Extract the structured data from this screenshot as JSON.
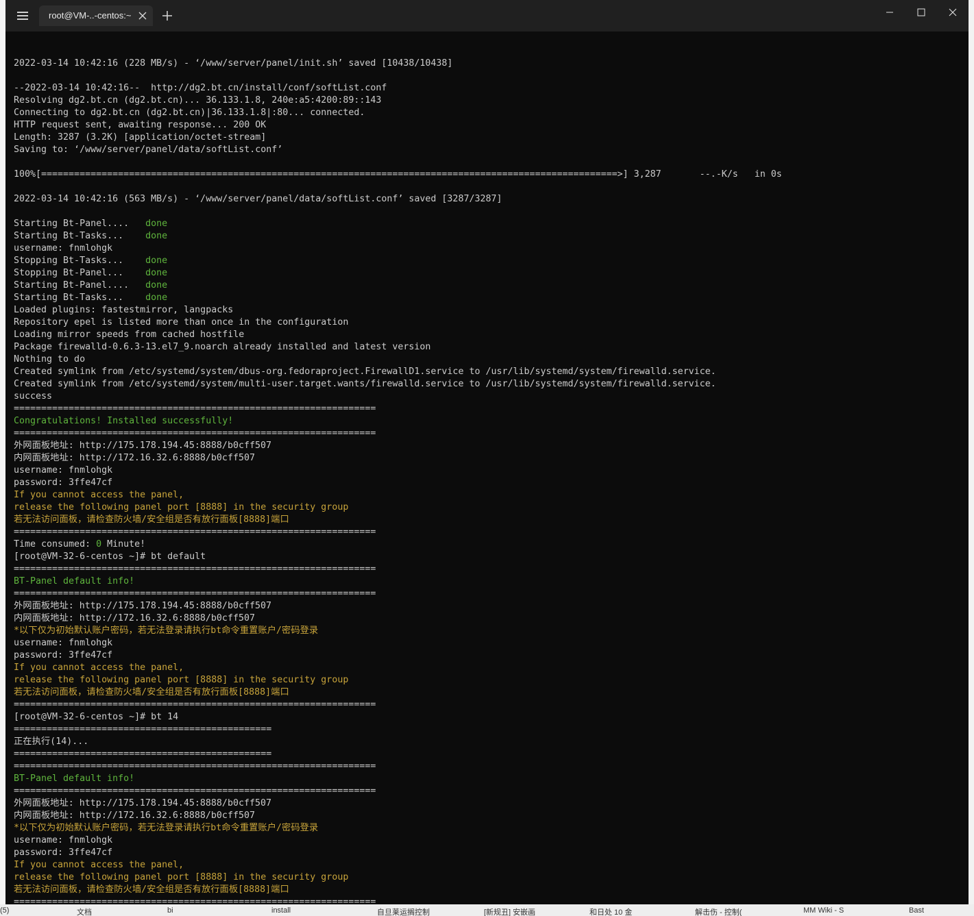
{
  "window": {
    "tab_title": "root@VM-..-centos:~"
  },
  "terminal": {
    "lines": [
      {
        "parts": [
          {
            "t": ""
          }
        ]
      },
      {
        "parts": [
          {
            "t": "2022-03-14 10:42:16 (228 MB/s) - ‘/www/server/panel/init.sh’ saved [10438/10438]"
          }
        ]
      },
      {
        "parts": [
          {
            "t": ""
          }
        ]
      },
      {
        "parts": [
          {
            "t": "--2022-03-14 10:42:16--  http://dg2.bt.cn/install/conf/softList.conf"
          }
        ]
      },
      {
        "parts": [
          {
            "t": "Resolving dg2.bt.cn (dg2.bt.cn)... 36.133.1.8, 240e:a5:4200:89::143"
          }
        ]
      },
      {
        "parts": [
          {
            "t": "Connecting to dg2.bt.cn (dg2.bt.cn)|36.133.1.8|:80... connected."
          }
        ]
      },
      {
        "parts": [
          {
            "t": "HTTP request sent, awaiting response... 200 OK"
          }
        ]
      },
      {
        "parts": [
          {
            "t": "Length: 3287 (3.2K) [application/octet-stream]"
          }
        ]
      },
      {
        "parts": [
          {
            "t": "Saving to: ‘/www/server/panel/data/softList.conf’"
          }
        ]
      },
      {
        "parts": [
          {
            "t": ""
          }
        ]
      },
      {
        "parts": [
          {
            "t": "100%[=========================================================================================================>] 3,287       --.-K/s   in 0s"
          }
        ]
      },
      {
        "parts": [
          {
            "t": ""
          }
        ]
      },
      {
        "parts": [
          {
            "t": "2022-03-14 10:42:16 (563 MB/s) - ‘/www/server/panel/data/softList.conf’ saved [3287/3287]"
          }
        ]
      },
      {
        "parts": [
          {
            "t": ""
          }
        ]
      },
      {
        "parts": [
          {
            "t": "Starting Bt-Panel....   "
          },
          {
            "t": "done",
            "c": "green"
          }
        ]
      },
      {
        "parts": [
          {
            "t": "Starting Bt-Tasks...    "
          },
          {
            "t": "done",
            "c": "green"
          }
        ]
      },
      {
        "parts": [
          {
            "t": "username: fnmlohgk"
          }
        ]
      },
      {
        "parts": [
          {
            "t": "Stopping Bt-Tasks...    "
          },
          {
            "t": "done",
            "c": "green"
          }
        ]
      },
      {
        "parts": [
          {
            "t": "Stopping Bt-Panel...    "
          },
          {
            "t": "done",
            "c": "green"
          }
        ]
      },
      {
        "parts": [
          {
            "t": "Starting Bt-Panel....   "
          },
          {
            "t": "done",
            "c": "green"
          }
        ]
      },
      {
        "parts": [
          {
            "t": "Starting Bt-Tasks...    "
          },
          {
            "t": "done",
            "c": "green"
          }
        ]
      },
      {
        "parts": [
          {
            "t": "Loaded plugins: fastestmirror, langpacks"
          }
        ]
      },
      {
        "parts": [
          {
            "t": "Repository epel is listed more than once in the configuration"
          }
        ]
      },
      {
        "parts": [
          {
            "t": "Loading mirror speeds from cached hostfile"
          }
        ]
      },
      {
        "parts": [
          {
            "t": "Package firewalld-0.6.3-13.el7_9.noarch already installed and latest version"
          }
        ]
      },
      {
        "parts": [
          {
            "t": "Nothing to do"
          }
        ]
      },
      {
        "parts": [
          {
            "t": "Created symlink from /etc/systemd/system/dbus-org.fedoraproject.FirewallD1.service to /usr/lib/systemd/system/firewalld.service."
          }
        ]
      },
      {
        "parts": [
          {
            "t": "Created symlink from /etc/systemd/system/multi-user.target.wants/firewalld.service to /usr/lib/systemd/system/firewalld.service."
          }
        ]
      },
      {
        "parts": [
          {
            "t": "success"
          }
        ]
      },
      {
        "parts": [
          {
            "t": "=================================================================="
          }
        ]
      },
      {
        "parts": [
          {
            "t": "Congratulations! Installed successfully!",
            "c": "green"
          }
        ]
      },
      {
        "parts": [
          {
            "t": "=================================================================="
          }
        ]
      },
      {
        "parts": [
          {
            "t": "外网面板地址: http://175.178.194.45:8888/b0cff507"
          }
        ]
      },
      {
        "parts": [
          {
            "t": "内网面板地址: http://172.16.32.6:8888/b0cff507"
          }
        ]
      },
      {
        "parts": [
          {
            "t": "username: fnmlohgk"
          }
        ]
      },
      {
        "parts": [
          {
            "t": "password: 3ffe47cf"
          }
        ]
      },
      {
        "parts": [
          {
            "t": "If you cannot access the panel,",
            "c": "yellow"
          }
        ]
      },
      {
        "parts": [
          {
            "t": "release the following panel port [8888] in the security group",
            "c": "yellow"
          }
        ]
      },
      {
        "parts": [
          {
            "t": "若无法访问面板，请检查防火墙/安全组是否有放行面板[8888]端口",
            "c": "yellow"
          }
        ]
      },
      {
        "parts": [
          {
            "t": "=================================================================="
          }
        ]
      },
      {
        "parts": [
          {
            "t": "Time consumed: "
          },
          {
            "t": "0",
            "c": "green"
          },
          {
            "t": " Minute!"
          }
        ]
      },
      {
        "parts": [
          {
            "t": "[root@VM-32-6-centos ~]# bt default"
          }
        ]
      },
      {
        "parts": [
          {
            "t": "=================================================================="
          }
        ]
      },
      {
        "parts": [
          {
            "t": "BT-Panel default info!",
            "c": "green"
          }
        ]
      },
      {
        "parts": [
          {
            "t": "=================================================================="
          }
        ]
      },
      {
        "parts": [
          {
            "t": "外网面板地址: http://175.178.194.45:8888/b0cff507"
          }
        ]
      },
      {
        "parts": [
          {
            "t": "内网面板地址: http://172.16.32.6:8888/b0cff507"
          }
        ]
      },
      {
        "parts": [
          {
            "t": "*以下仅为初始默认账户密码，若无法登录请执行bt命令重置账户/密码登录",
            "c": "yellow"
          }
        ]
      },
      {
        "parts": [
          {
            "t": "username: fnmlohgk"
          }
        ]
      },
      {
        "parts": [
          {
            "t": "password: 3ffe47cf"
          }
        ]
      },
      {
        "parts": [
          {
            "t": "If you cannot access the panel,",
            "c": "yellow"
          }
        ]
      },
      {
        "parts": [
          {
            "t": "release the following panel port [8888] in the security group",
            "c": "yellow"
          }
        ]
      },
      {
        "parts": [
          {
            "t": "若无法访问面板，请检查防火墙/安全组是否有放行面板[8888]端口",
            "c": "yellow"
          }
        ]
      },
      {
        "parts": [
          {
            "t": "=================================================================="
          }
        ]
      },
      {
        "parts": [
          {
            "t": "[root@VM-32-6-centos ~]# bt 14"
          }
        ]
      },
      {
        "parts": [
          {
            "t": "==============================================="
          }
        ]
      },
      {
        "parts": [
          {
            "t": "正在执行(14)..."
          }
        ]
      },
      {
        "parts": [
          {
            "t": "==============================================="
          }
        ]
      },
      {
        "parts": [
          {
            "t": "=================================================================="
          }
        ]
      },
      {
        "parts": [
          {
            "t": "BT-Panel default info!",
            "c": "green"
          }
        ]
      },
      {
        "parts": [
          {
            "t": "=================================================================="
          }
        ]
      },
      {
        "parts": [
          {
            "t": "外网面板地址: http://175.178.194.45:8888/b0cff507"
          }
        ]
      },
      {
        "parts": [
          {
            "t": "内网面板地址: http://172.16.32.6:8888/b0cff507"
          }
        ]
      },
      {
        "parts": [
          {
            "t": "*以下仅为初始默认账户密码，若无法登录请执行bt命令重置账户/密码登录",
            "c": "yellow"
          }
        ]
      },
      {
        "parts": [
          {
            "t": "username: fnmlohgk"
          }
        ]
      },
      {
        "parts": [
          {
            "t": "password: 3ffe47cf"
          }
        ]
      },
      {
        "parts": [
          {
            "t": "If you cannot access the panel,",
            "c": "yellow"
          }
        ]
      },
      {
        "parts": [
          {
            "t": "release the following panel port [8888] in the security group",
            "c": "yellow"
          }
        ]
      },
      {
        "parts": [
          {
            "t": "若无法访问面板，请检查防火墙/安全组是否有放行面板[8888]端口",
            "c": "yellow"
          }
        ]
      },
      {
        "parts": [
          {
            "t": "=================================================================="
          }
        ]
      }
    ]
  },
  "taskbar": {
    "items": [
      "(5)",
      "文档",
      "bi",
      "install",
      "自旦莱运搁控制",
      "[新规丑] 安嵌画",
      "和日处 10 金",
      "解击伤 - 控制(",
      "MM Wiki - S",
      "Bast"
    ]
  },
  "colors": {
    "terminal_bg": "#0c0c0c",
    "terminal_fg": "#cccccc",
    "green": "#5fb53d",
    "yellow": "#c7a33a",
    "titlebar_bg": "#202020"
  },
  "icons": {
    "menu": "hamburger-icon",
    "tab_close": "close-icon",
    "new_tab": "plus-icon",
    "minimize": "minimize-icon",
    "maximize": "maximize-icon",
    "close": "close-icon"
  }
}
